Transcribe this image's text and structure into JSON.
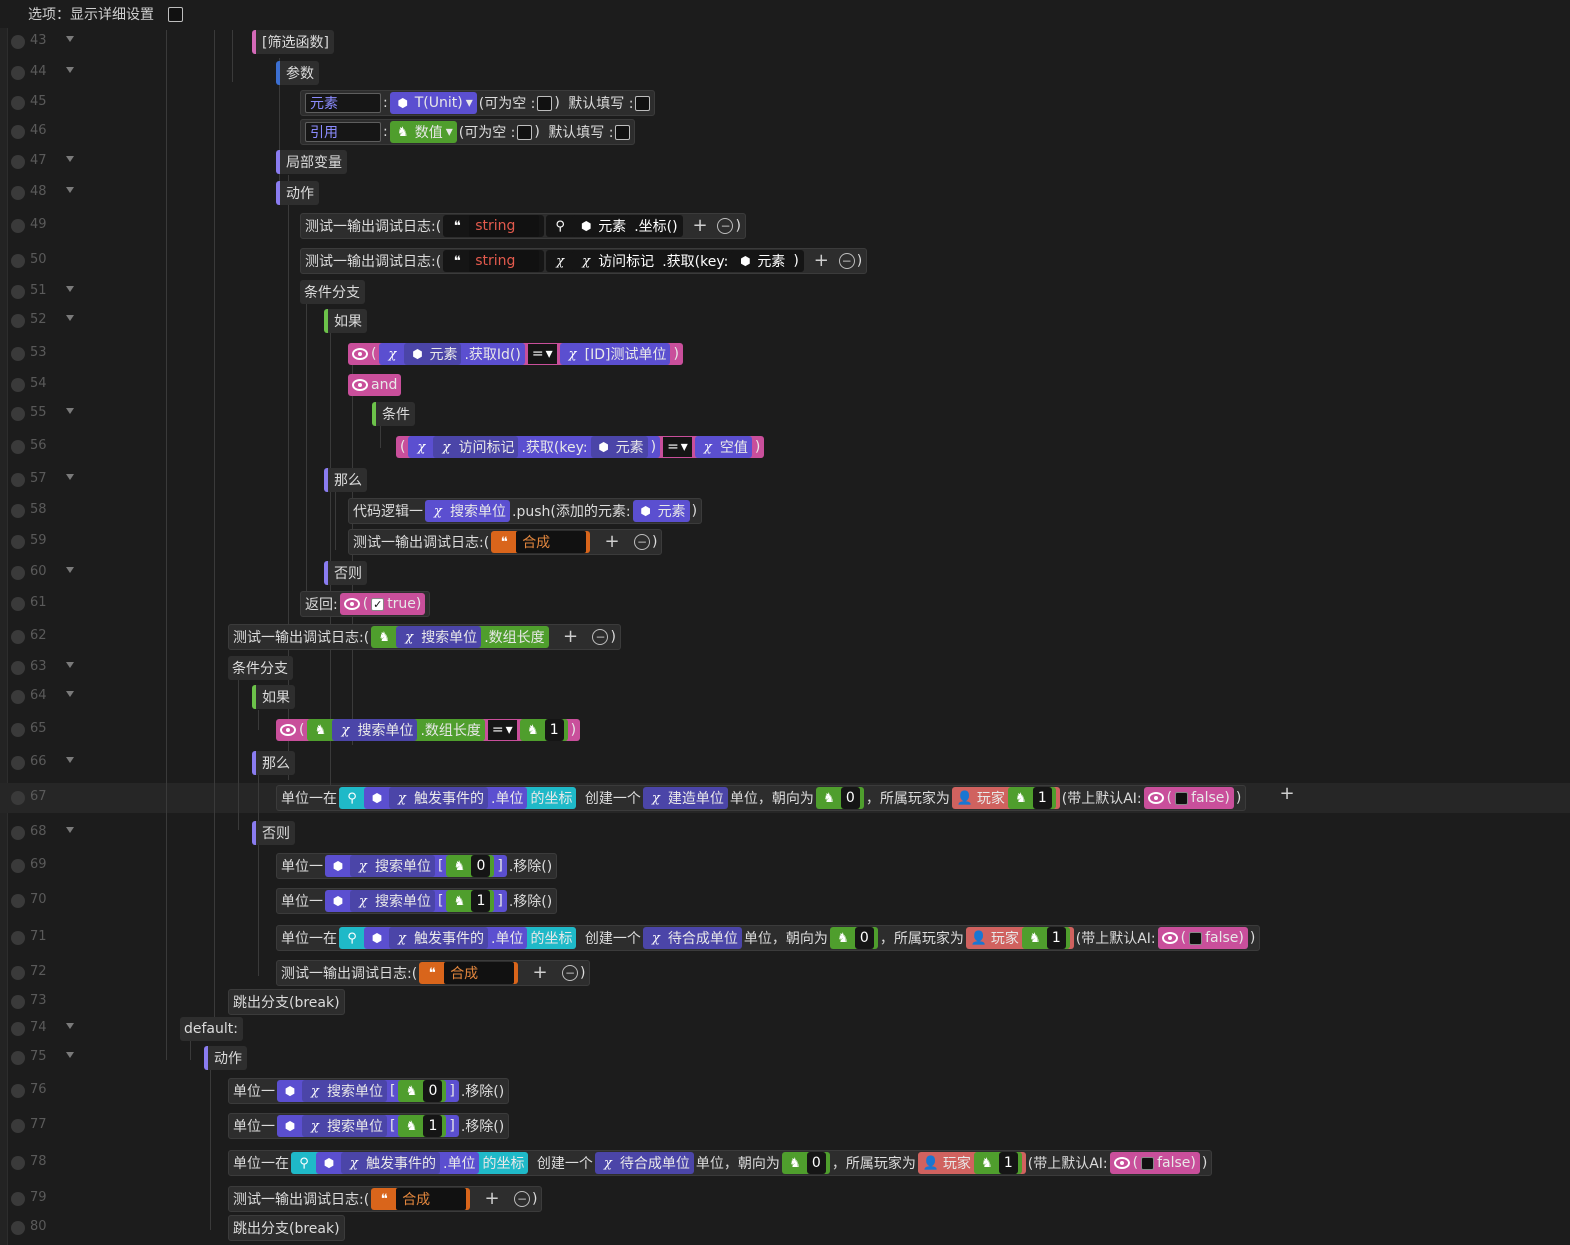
{
  "topbar": {
    "label": "选项：显示详细设置"
  },
  "lines": [
    "43",
    "44",
    "45",
    "46",
    "47",
    "48",
    "49",
    "50",
    "51",
    "52",
    "53",
    "54",
    "55",
    "56",
    "57",
    "58",
    "59",
    "60",
    "61",
    "62",
    "63",
    "64",
    "65",
    "66",
    "67",
    "68",
    "69",
    "70",
    "71",
    "72",
    "73",
    "74",
    "75",
    "76",
    "77",
    "78",
    "79",
    "80"
  ],
  "t": {
    "filter_fn": "[筛选函数]",
    "params": "参数",
    "elem": "元素",
    "ref": "引用",
    "tunit": "T(Unit)",
    "num": "数值",
    "nullable": "(可为空 :",
    "close_paren": ")",
    "default_fill": "默认填写 :",
    "local_vars": "局部变量",
    "action": "动作",
    "debug_log": "测试一输出调试日志:(",
    "string": "string",
    "coord": ".坐标()",
    "visit_mark": "访问标记",
    "get_key": ".获取(key:",
    "cond_branch": "条件分支",
    "if": "如果",
    "get_id": ".获取Id()",
    "eq": "=",
    "id_test_unit": "[ID]测试单位",
    "and": "and",
    "cond": "条件",
    "null_val": "空值",
    "then": "那么",
    "code_logic": "代码逻辑一",
    "search_units": "搜索单位",
    "push": ".push(添加的元素:",
    "synth": "合成",
    "else": "否则",
    "return": "返回:",
    "true": "true)",
    "arr_len": ".数组长度",
    "one": "1",
    "zero": "0",
    "unit_at": "单位一在",
    "trigger": "触发事件的",
    "dot_unit": ".单位",
    "coord_of": "的坐标",
    "create_one": "创建一个",
    "build_unit": "建造单位",
    "facing": "单位，朝向为",
    "owner": "，所属玩家为",
    "player": "玩家",
    "default_ai": "(带上默认AI:",
    "false": "false)",
    "unit_dash": "单位一",
    "remove": ".移除()",
    "pending_unit": "待合成单位",
    "break": "跳出分支(break)",
    "default": "default:",
    "lbr": "[",
    "rbr": "]",
    "paren": "(",
    "cparen": ")",
    "colon": ":"
  }
}
